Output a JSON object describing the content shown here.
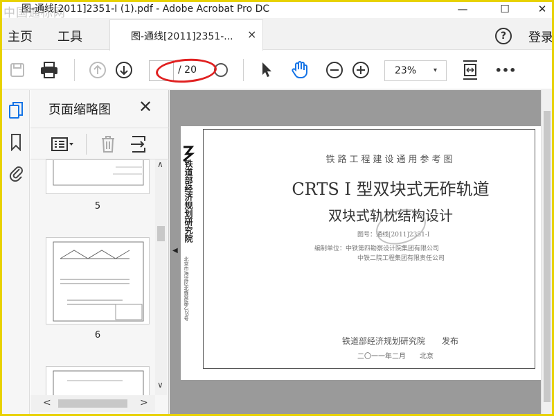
{
  "window": {
    "watermark": "中国通标网",
    "title": "图-通线[2011]2351-I (1).pdf - Adobe Acrobat Pro DC",
    "minimize": "—",
    "maximize": "☐",
    "close": "✕"
  },
  "menubar": {
    "home": "主页",
    "tools": "工具",
    "tab_label": "图-通线[2011]2351-...",
    "tab_close": "×",
    "help": "?",
    "login": "登录"
  },
  "toolbar": {
    "save_icon": "save-icon",
    "print_icon": "print-icon",
    "prev_page_icon": "arrow-up-circle-icon",
    "next_page_icon": "arrow-down-circle-icon",
    "page_current": "",
    "page_total": "/ 20",
    "select_icon": "cursor-arrow-icon",
    "hand_icon": "hand-icon",
    "zoom_out_icon": "minus-circle-icon",
    "zoom_in_icon": "plus-circle-icon",
    "zoom_value": "23%",
    "zoom_caret": "▾",
    "fit_icon": "fit-page-icon",
    "more": "•••",
    "annotation_color": "#e02020"
  },
  "rail": {
    "icons": [
      "pages-icon",
      "bookmark-icon",
      "attachment-icon"
    ],
    "active_color": "#1473e6"
  },
  "thumbpanel": {
    "title": "页面缩略图",
    "close": "✕",
    "thumbs": [
      {
        "label": "5"
      },
      {
        "label": "6"
      },
      {
        "label": ""
      }
    ],
    "scroll_up": "∧",
    "scroll_down": "∨",
    "scroll_left": "<",
    "scroll_right": ">"
  },
  "document": {
    "spine_org": "铁道部经济规划研究院",
    "spine_address": "北京市海淀区北蜂窝路乙29号",
    "series": "铁路工程建设通用参考图",
    "title": "CRTS I 型双块式无砟轨道",
    "subtitle": "双块式轨枕结构设计",
    "drawing_no": "图号：通线[2011]2351-I",
    "compiler1": "编制单位：中铁第四勘察设计院集团有限公司",
    "compiler2": "中铁二院工程集团有限责任公司",
    "publisher": "铁道部经济规划研究院　　发布",
    "date": "二〇一一年二月　　北京",
    "collapse_handle": "◀"
  }
}
